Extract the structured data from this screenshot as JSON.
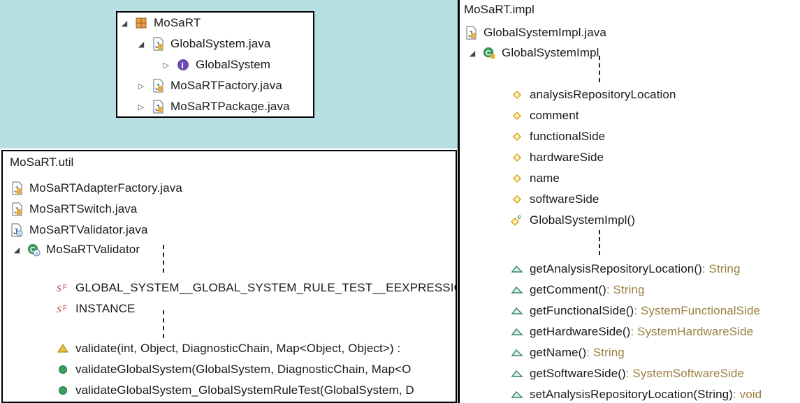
{
  "top_tree": {
    "package": "MoSaRT",
    "items": [
      {
        "label": "GlobalSystem.java",
        "icon": "java-file-icon",
        "expanded": true
      },
      {
        "label": "GlobalSystem",
        "icon": "interface-icon",
        "expanded": false
      },
      {
        "label": "MoSaRTFactory.java",
        "icon": "java-file-icon",
        "expanded": false
      },
      {
        "label": "MoSaRTPackage.java",
        "icon": "java-file-icon",
        "expanded": false
      }
    ]
  },
  "util": {
    "header": "MoSaRT.util",
    "files": [
      {
        "label": "MoSaRTAdapterFactory.java"
      },
      {
        "label": "MoSaRTSwitch.java"
      },
      {
        "label": "MoSaRTValidator.java"
      }
    ],
    "class_name": "MoSaRTValidator",
    "fields": [
      {
        "label": "GLOBAL_SYSTEM__GLOBAL_SYSTEM_RULE_TEST__EEXPRESSIO"
      },
      {
        "label": "INSTANCE"
      }
    ],
    "methods": [
      {
        "label": "validate(int, Object, DiagnosticChain, Map<Object, Object>) :"
      },
      {
        "label": "validateGlobalSystem(GlobalSystem, DiagnosticChain, Map<O"
      },
      {
        "label": "validateGlobalSystem_GlobalSystemRuleTest(GlobalSystem, D"
      }
    ]
  },
  "impl": {
    "header": "MoSaRT.impl",
    "file": "GlobalSystemImpl.java",
    "class_name": "GlobalSystemImpl",
    "fields": [
      "analysisRepositoryLocation",
      "comment",
      "functionalSide",
      "hardwareSide",
      "name",
      "softwareSide"
    ],
    "constructor": "GlobalSystemImpl()",
    "methods": [
      {
        "name": "getAnalysisRepositoryLocation()",
        "type": " : String"
      },
      {
        "name": "getComment()",
        "type": " : String"
      },
      {
        "name": "getFunctionalSide()",
        "type": " : SystemFunctionalSide"
      },
      {
        "name": "getHardwareSide()",
        "type": " : SystemHardwareSide"
      },
      {
        "name": "getName()",
        "type": " : String"
      },
      {
        "name": "getSoftwareSide()",
        "type": " : SystemSoftwareSide"
      },
      {
        "name": "setAnalysisRepositoryLocation(String)",
        "type": " : void"
      }
    ]
  },
  "colors": {
    "background_teal": "#b7dfe1",
    "type_annotation": "#9a7f3f",
    "method_icon": "#3a8a6a",
    "field_icon": "#d9a520"
  }
}
